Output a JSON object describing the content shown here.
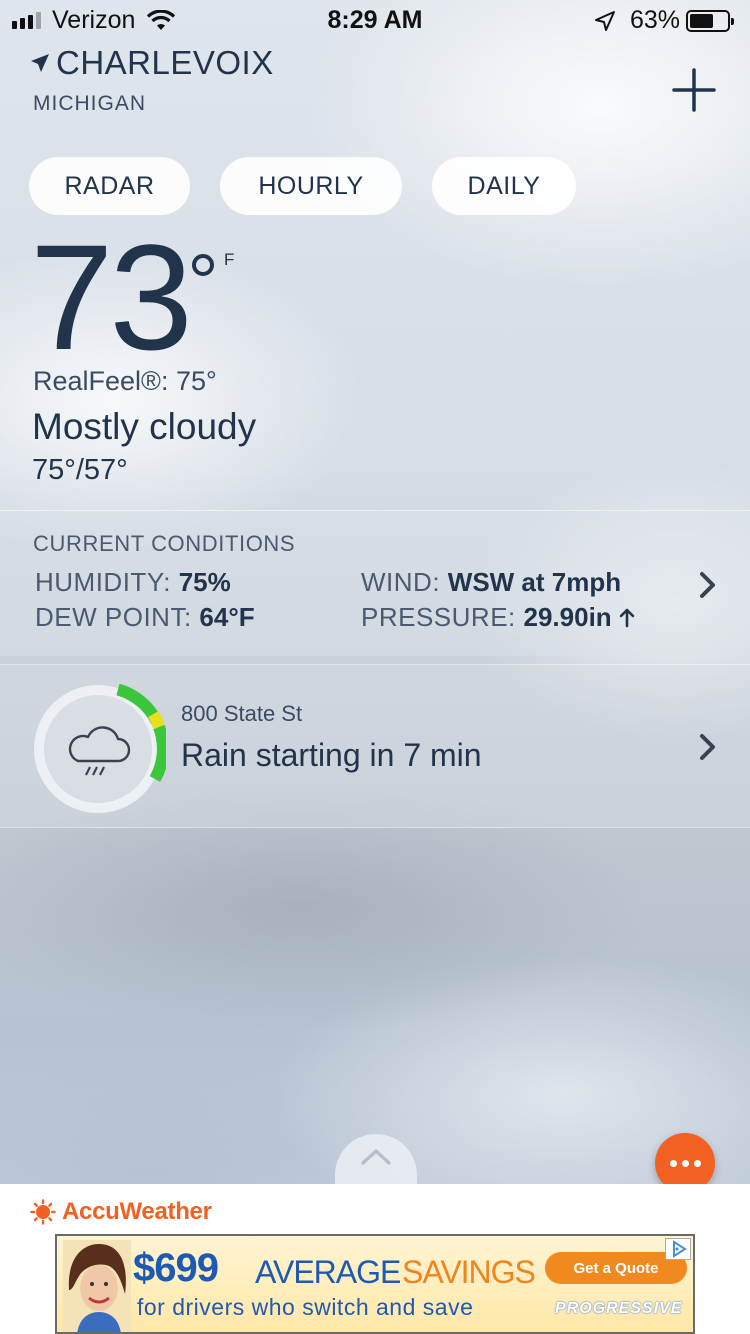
{
  "status_bar": {
    "carrier": "Verizon",
    "time": "8:29 AM",
    "battery_percent": "63%",
    "battery_level": 0.63
  },
  "header": {
    "city": "CHARLEVOIX",
    "region": "MICHIGAN",
    "add_icon": "plus-icon"
  },
  "tabs": [
    {
      "label": "RADAR"
    },
    {
      "label": "HOURLY"
    },
    {
      "label": "DAILY"
    }
  ],
  "current": {
    "temperature": "73",
    "unit": "F",
    "realfeel": "RealFeel®: 75°",
    "condition": "Mostly cloudy",
    "hi_lo": "75°/57°"
  },
  "current_conditions": {
    "title": "CURRENT CONDITIONS",
    "humidity_label": "HUMIDITY:",
    "humidity_value": "75%",
    "dew_point_label": "DEW POINT:",
    "dew_point_value": "64°F",
    "wind_label": "WIND:",
    "wind_value": "WSW at 7mph",
    "pressure_label": "PRESSURE:",
    "pressure_value": "29.90in",
    "pressure_trend_icon": "arrow-up-icon"
  },
  "minute_cast": {
    "address": "800 State St",
    "message": "Rain starting in 7 min",
    "icon": "rain-cloud-icon"
  },
  "footer": {
    "brand": "AccuWeather",
    "ad": {
      "price": "$699",
      "average": "AVERAGE",
      "savings": "SAVINGS",
      "subtitle": "for drivers who switch and save",
      "cta": "Get a Quote",
      "advertiser": "PROGRESSIVE"
    }
  },
  "colors": {
    "text_dark": "#22344b",
    "accent_orange": "#f26122",
    "gauge_green": "#3cc63c",
    "gauge_yellow": "#e8e01e"
  }
}
